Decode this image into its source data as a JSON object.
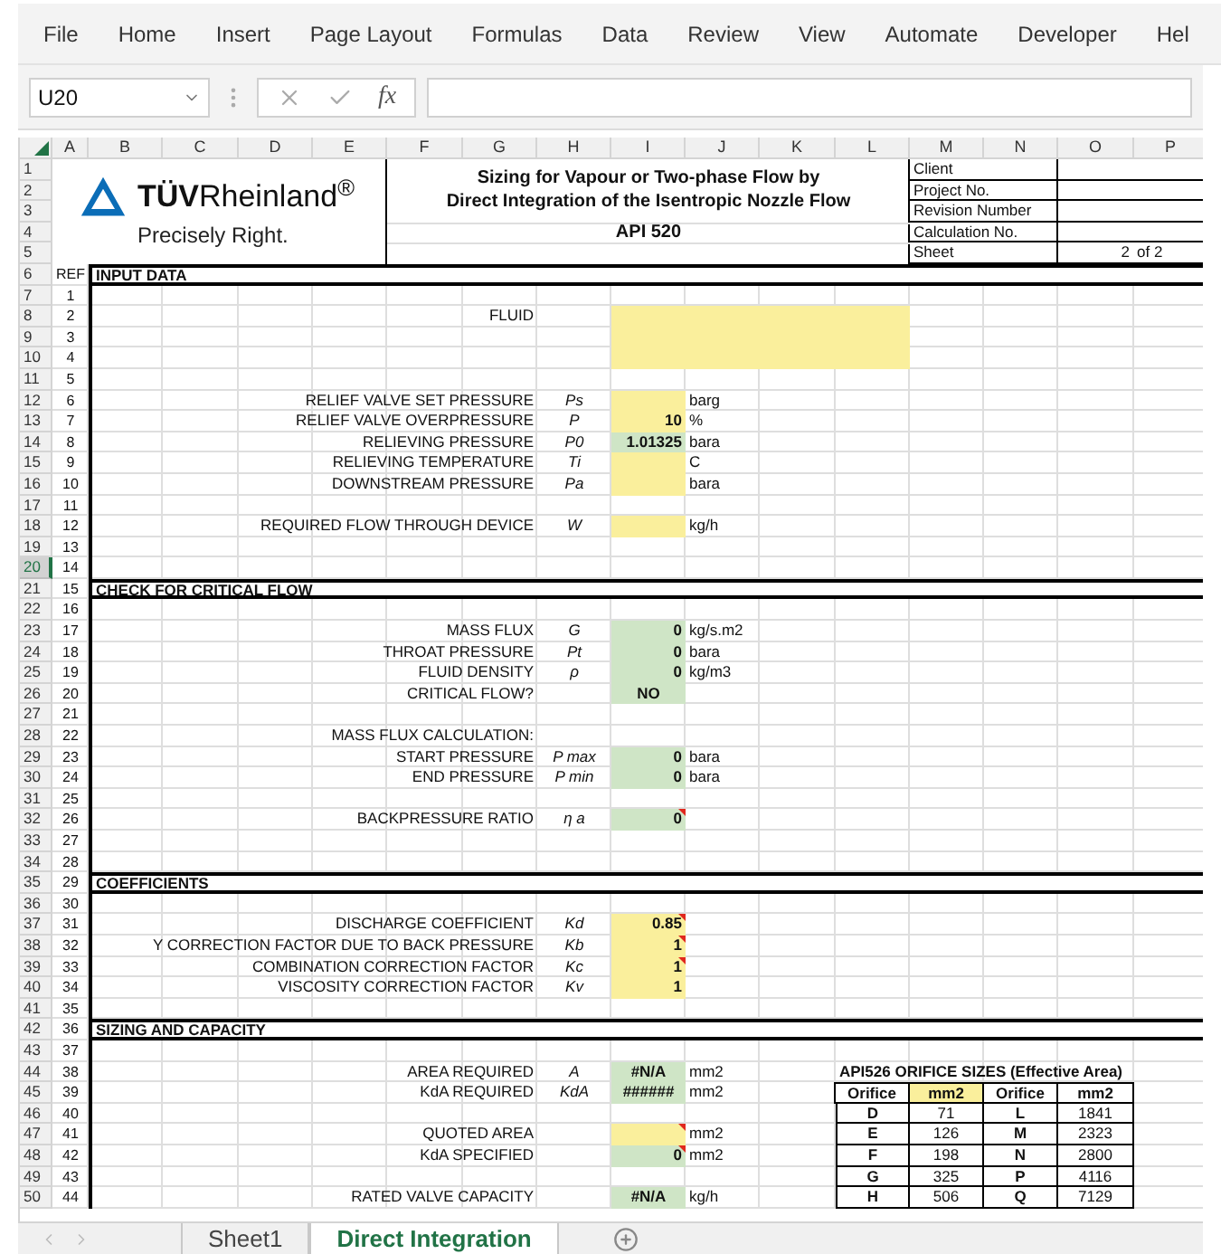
{
  "menu": [
    {
      "label": "File"
    },
    {
      "label": "Home"
    },
    {
      "label": "Insert"
    },
    {
      "label": "Page Layout"
    },
    {
      "label": "Formulas"
    },
    {
      "label": "Data"
    },
    {
      "label": "Review"
    },
    {
      "label": "View"
    },
    {
      "label": "Automate"
    },
    {
      "label": "Developer"
    },
    {
      "label": "Hel"
    }
  ],
  "formula_bar": {
    "name_box": "U20",
    "function_label": "fx"
  },
  "columns": [
    {
      "label": "A"
    },
    {
      "label": "B"
    },
    {
      "label": "C"
    },
    {
      "label": "D"
    },
    {
      "label": "E"
    },
    {
      "label": "F"
    },
    {
      "label": "G"
    },
    {
      "label": "H"
    },
    {
      "label": "I"
    },
    {
      "label": "J"
    },
    {
      "label": "K"
    },
    {
      "label": "L"
    },
    {
      "label": "M"
    },
    {
      "label": "N"
    },
    {
      "label": "O"
    },
    {
      "label": "P"
    }
  ],
  "header": {
    "brand": "**TÜV**Rheinland$^{®}$",
    "tagline": "Precisely Right.",
    "title_lines": [
      "Sizing for Vapour or Two-phase Flow by",
      "Direct Integration of the Isentropic Nozzle Flow"
    ],
    "standard": "API 520",
    "info": [
      {
        "label": "Client"
      },
      {
        "label": "Project No."
      },
      {
        "label": "Revision Number"
      },
      {
        "label": "Calculation No."
      },
      {
        "label": "Sheet",
        "value": "2",
        "value_2": "of 2"
      }
    ]
  },
  "rows": [
    {
      "row_number": "1",
      "selected": false
    },
    {
      "row_number": "2",
      "selected": false
    },
    {
      "row_number": "3",
      "selected": false
    },
    {
      "row_number": "4",
      "selected": false
    },
    {
      "row_number": "5",
      "selected": false
    },
    {
      "row_number": "6",
      "selected": false,
      "ref": "REF",
      "section": "INPUT DATA"
    },
    {
      "row_number": "7",
      "selected": false,
      "ref": "1"
    },
    {
      "row_number": "8",
      "selected": false,
      "ref": "2",
      "label": "FLUID",
      "kind": "input_block",
      "comment": false
    },
    {
      "row_number": "9",
      "selected": false,
      "ref": "3"
    },
    {
      "row_number": "10",
      "selected": false,
      "ref": "4"
    },
    {
      "row_number": "11",
      "selected": false,
      "ref": "5"
    },
    {
      "row_number": "12",
      "selected": false,
      "ref": "6",
      "label": "RELIEF VALVE SET PRESSURE",
      "symbol": "Ps",
      "kind": "input",
      "unit": "barg",
      "comment": false
    },
    {
      "row_number": "13",
      "selected": false,
      "ref": "7",
      "label": "RELIEF VALVE OVERPRESSURE",
      "symbol": "P",
      "kind": "input",
      "value": "10",
      "unit": "%",
      "comment": false
    },
    {
      "row_number": "14",
      "selected": false,
      "ref": "8",
      "label": "RELIEVING PRESSURE",
      "symbol": "P0",
      "kind": "calculated",
      "value": "1.01325",
      "unit": "bara",
      "comment": false
    },
    {
      "row_number": "15",
      "selected": false,
      "ref": "9",
      "label": "RELIEVING TEMPERATURE",
      "symbol": "Ti",
      "kind": "input",
      "unit": "C",
      "comment": false
    },
    {
      "row_number": "16",
      "selected": false,
      "ref": "10",
      "label": "DOWNSTREAM PRESSURE",
      "symbol": "Pa",
      "kind": "input",
      "unit": "bara",
      "comment": false
    },
    {
      "row_number": "17",
      "selected": false,
      "ref": "11"
    },
    {
      "row_number": "18",
      "selected": false,
      "ref": "12",
      "label": "REQUIRED FLOW THROUGH DEVICE",
      "symbol": "W",
      "kind": "input",
      "unit": "kg/h",
      "comment": false
    },
    {
      "row_number": "19",
      "selected": false,
      "ref": "13"
    },
    {
      "row_number": "20",
      "selected": true,
      "ref": "14"
    },
    {
      "row_number": "21",
      "selected": false,
      "ref": "15",
      "section": "CHECK FOR CRITICAL FLOW"
    },
    {
      "row_number": "22",
      "selected": false,
      "ref": "16"
    },
    {
      "row_number": "23",
      "selected": false,
      "ref": "17",
      "label": "MASS FLUX",
      "symbol": "G",
      "kind": "calculated",
      "value": "0",
      "unit": "kg/s.m2",
      "comment": false
    },
    {
      "row_number": "24",
      "selected": false,
      "ref": "18",
      "label": "THROAT PRESSURE",
      "symbol": "Pt",
      "kind": "calculated",
      "value": "0",
      "unit": "bara",
      "comment": false
    },
    {
      "row_number": "25",
      "selected": false,
      "ref": "19",
      "label": "FLUID DENSITY",
      "symbol": "ρ",
      "kind": "calculated",
      "value": "0",
      "unit": "kg/m3",
      "comment": false
    },
    {
      "row_number": "26",
      "selected": false,
      "ref": "20",
      "label": "CRITICAL FLOW?",
      "kind": "calculated_text",
      "value": "NO",
      "comment": false
    },
    {
      "row_number": "27",
      "selected": false,
      "ref": "21"
    },
    {
      "row_number": "28",
      "selected": false,
      "ref": "22",
      "label": "MASS FLUX CALCULATION:"
    },
    {
      "row_number": "29",
      "selected": false,
      "ref": "23",
      "label": "START PRESSURE",
      "symbol": "P max",
      "kind": "calculated",
      "value": "0",
      "unit": "bara",
      "comment": false
    },
    {
      "row_number": "30",
      "selected": false,
      "ref": "24",
      "label": "END PRESSURE",
      "symbol": "P min",
      "kind": "calculated",
      "value": "0",
      "unit": "bara",
      "comment": false
    },
    {
      "row_number": "31",
      "selected": false,
      "ref": "25"
    },
    {
      "row_number": "32",
      "selected": false,
      "ref": "26",
      "label": "BACKPRESSURE RATIO",
      "symbol": "η a",
      "kind": "calculated",
      "value": "0",
      "comment": true
    },
    {
      "row_number": "33",
      "selected": false,
      "ref": "27"
    },
    {
      "row_number": "34",
      "selected": false,
      "ref": "28"
    },
    {
      "row_number": "35",
      "selected": false,
      "ref": "29",
      "section": "COEFFICIENTS"
    },
    {
      "row_number": "36",
      "selected": false,
      "ref": "30"
    },
    {
      "row_number": "37",
      "selected": false,
      "ref": "31",
      "label": "DISCHARGE COEFFICIENT",
      "symbol": "Kd",
      "kind": "input",
      "value": "0.85",
      "comment": true
    },
    {
      "row_number": "38",
      "selected": false,
      "ref": "32",
      "label": "Y CORRECTION FACTOR DUE TO BACK PRESSURE",
      "symbol": "Kb",
      "kind": "input",
      "value": "1",
      "comment": true
    },
    {
      "row_number": "39",
      "selected": false,
      "ref": "33",
      "label": "COMBINATION CORRECTION FACTOR",
      "symbol": "Kc",
      "kind": "input",
      "value": "1",
      "comment": true
    },
    {
      "row_number": "40",
      "selected": false,
      "ref": "34",
      "label": "VISCOSITY CORRECTION FACTOR",
      "symbol": "Kv",
      "kind": "input",
      "value": "1",
      "comment": false
    },
    {
      "row_number": "41",
      "selected": false,
      "ref": "35"
    },
    {
      "row_number": "42",
      "selected": false,
      "ref": "36",
      "section": "SIZING AND CAPACITY"
    },
    {
      "row_number": "43",
      "selected": false,
      "ref": "37"
    },
    {
      "row_number": "44",
      "selected": false,
      "ref": "38",
      "label": "AREA REQUIRED",
      "symbol": "A",
      "kind": "calculated_text",
      "value": "#N/A",
      "unit": "mm2",
      "comment": false
    },
    {
      "row_number": "45",
      "selected": false,
      "ref": "39",
      "label": "KdA REQUIRED",
      "symbol": "KdA",
      "kind": "calculated_text",
      "value": "######",
      "unit": "mm2",
      "comment": false
    },
    {
      "row_number": "46",
      "selected": false,
      "ref": "40"
    },
    {
      "row_number": "47",
      "selected": false,
      "ref": "41",
      "label": "QUOTED AREA",
      "kind": "input",
      "unit": "mm2",
      "comment": true
    },
    {
      "row_number": "48",
      "selected": false,
      "ref": "42",
      "label": "KdA SPECIFIED",
      "kind": "calculated",
      "value": "0",
      "unit": "mm2",
      "comment": true
    },
    {
      "row_number": "49",
      "selected": false,
      "ref": "43"
    },
    {
      "row_number": "50",
      "selected": false,
      "ref": "44",
      "label": "RATED VALVE CAPACITY",
      "kind": "calculated_text",
      "value": "#N/A",
      "unit": "kg/h",
      "comment": false
    }
  ],
  "orifice_table": {
    "title": "API526 ORIFICE SIZES  (Effective Area)",
    "headers": [
      {
        "label": "Orifice",
        "highlighted": false
      },
      {
        "label": "mm2",
        "highlighted": true
      },
      {
        "label": "Orifice",
        "highlighted": false
      },
      {
        "label": "mm2",
        "highlighted": false
      }
    ],
    "rows": [
      [
        "D",
        "71",
        "L",
        "1841"
      ],
      [
        "E",
        "126",
        "M",
        "2323"
      ],
      [
        "F",
        "198",
        "N",
        "2800"
      ],
      [
        "G",
        "325",
        "P",
        "4116"
      ],
      [
        "H",
        "506",
        "Q",
        "7129"
      ]
    ]
  },
  "sheet_tabs": [
    {
      "label": "Sheet1",
      "selected": false
    },
    {
      "label": "Direct Integration",
      "selected": true
    }
  ]
}
